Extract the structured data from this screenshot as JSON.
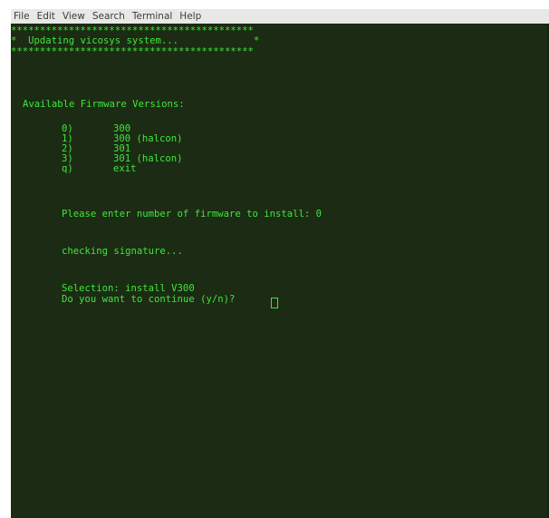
{
  "menubar": {
    "items": [
      "File",
      "Edit",
      "View",
      "Search",
      "Terminal",
      "Help"
    ]
  },
  "terminal": {
    "banner_top": "******************************************",
    "banner_text": "*  Updating vicosys system...             *",
    "banner_bottom": "******************************************",
    "header": "Available Firmware Versions:",
    "options": [
      {
        "key": "0)",
        "label": "300"
      },
      {
        "key": "1)",
        "label": "300 (halcon)"
      },
      {
        "key": "2)",
        "label": "301"
      },
      {
        "key": "3)",
        "label": "301 (halcon)"
      },
      {
        "key": "q)",
        "label": "exit"
      }
    ],
    "prompt": "Please enter number of firmware to install: 0",
    "checking": "checking signature...",
    "selection": "Selection: install V300",
    "confirm": "Do you want to continue (y/n)? "
  },
  "colors": {
    "terminal_bg": "#1c2b13",
    "terminal_fg": "#3ee63e",
    "menubar_bg": "#e8e8e7"
  }
}
